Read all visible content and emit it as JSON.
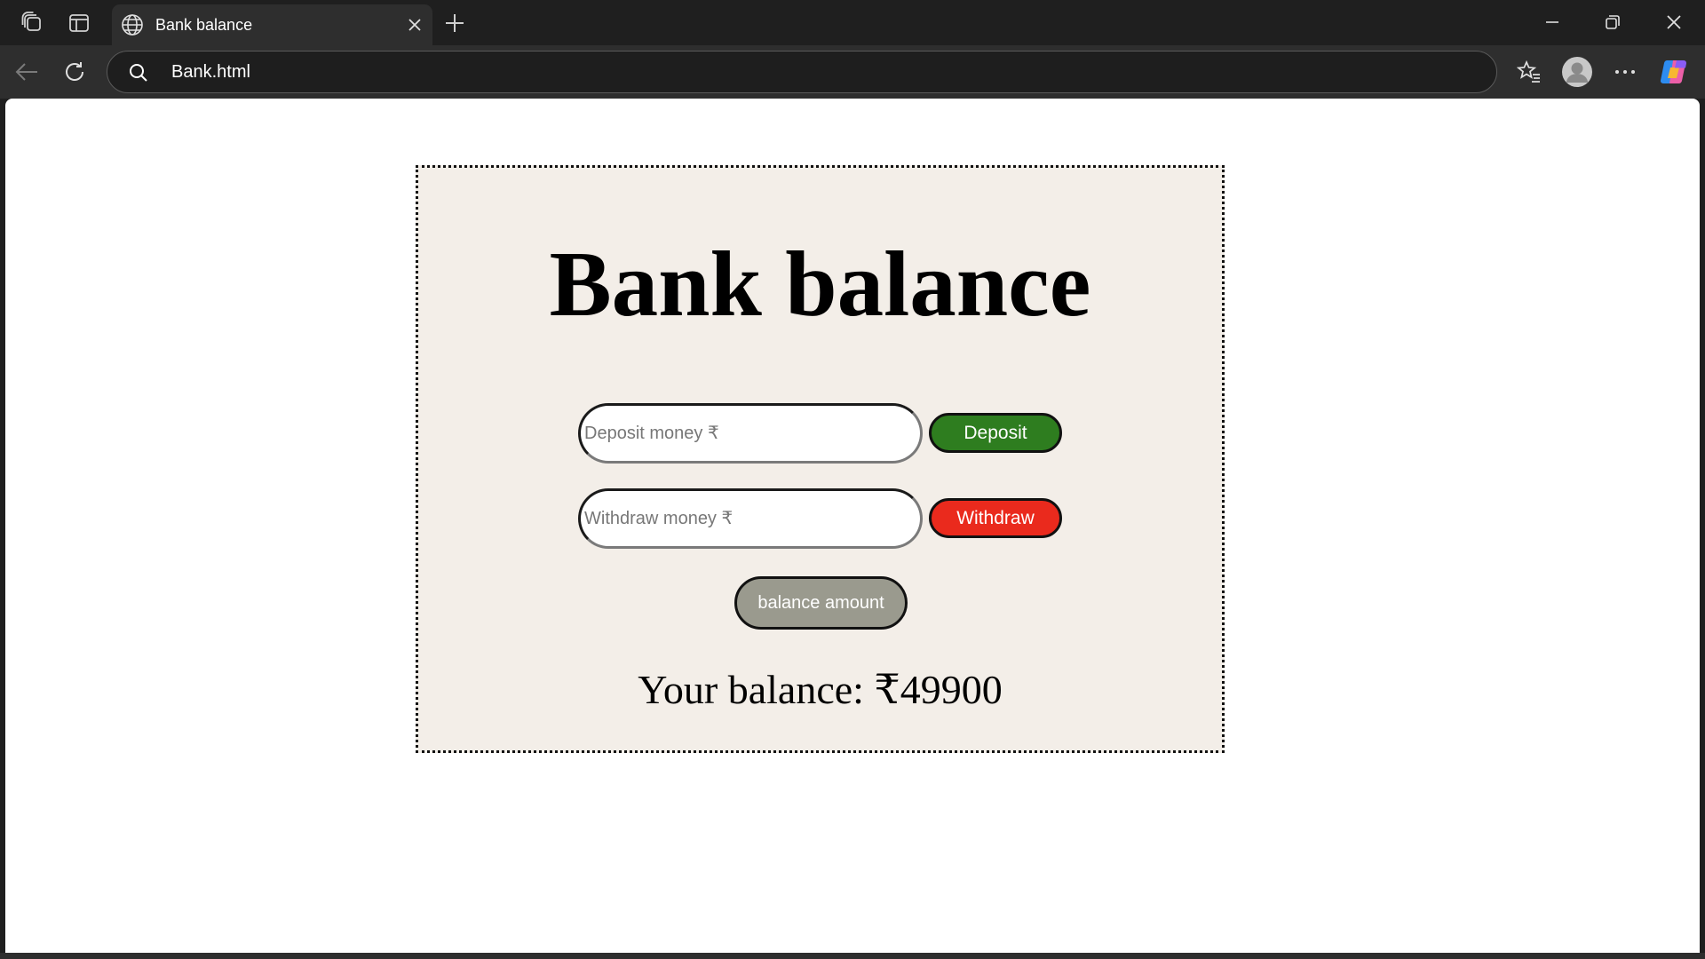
{
  "browser": {
    "tab": {
      "title": "Bank balance"
    },
    "address_bar": {
      "url": "Bank.html"
    }
  },
  "page": {
    "heading": "Bank balance",
    "deposit": {
      "placeholder": "Deposit money ₹",
      "value": "",
      "button_label": "Deposit",
      "button_color": "#2e7d1f"
    },
    "withdraw": {
      "placeholder": "Withdraw money ₹",
      "value": "",
      "button_label": "Withdraw",
      "button_color": "#ea2a1d"
    },
    "balance_button_label": "balance amount",
    "balance_text": "Your balance: ₹49900"
  },
  "icons": {
    "tab_actions": "tab-actions-icon",
    "vertical_tabs": "vertical-tabs-icon",
    "favicon": "globe-icon",
    "tab_close": "close-icon",
    "new_tab": "plus-icon",
    "minimize": "minimize-icon",
    "restore": "restore-icon",
    "window_close": "close-icon",
    "back": "back-arrow-icon",
    "refresh": "refresh-icon",
    "search": "search-icon",
    "favorites": "star-list-icon",
    "profile": "avatar-icon",
    "more": "ellipsis-icon",
    "copilot": "copilot-icon"
  }
}
